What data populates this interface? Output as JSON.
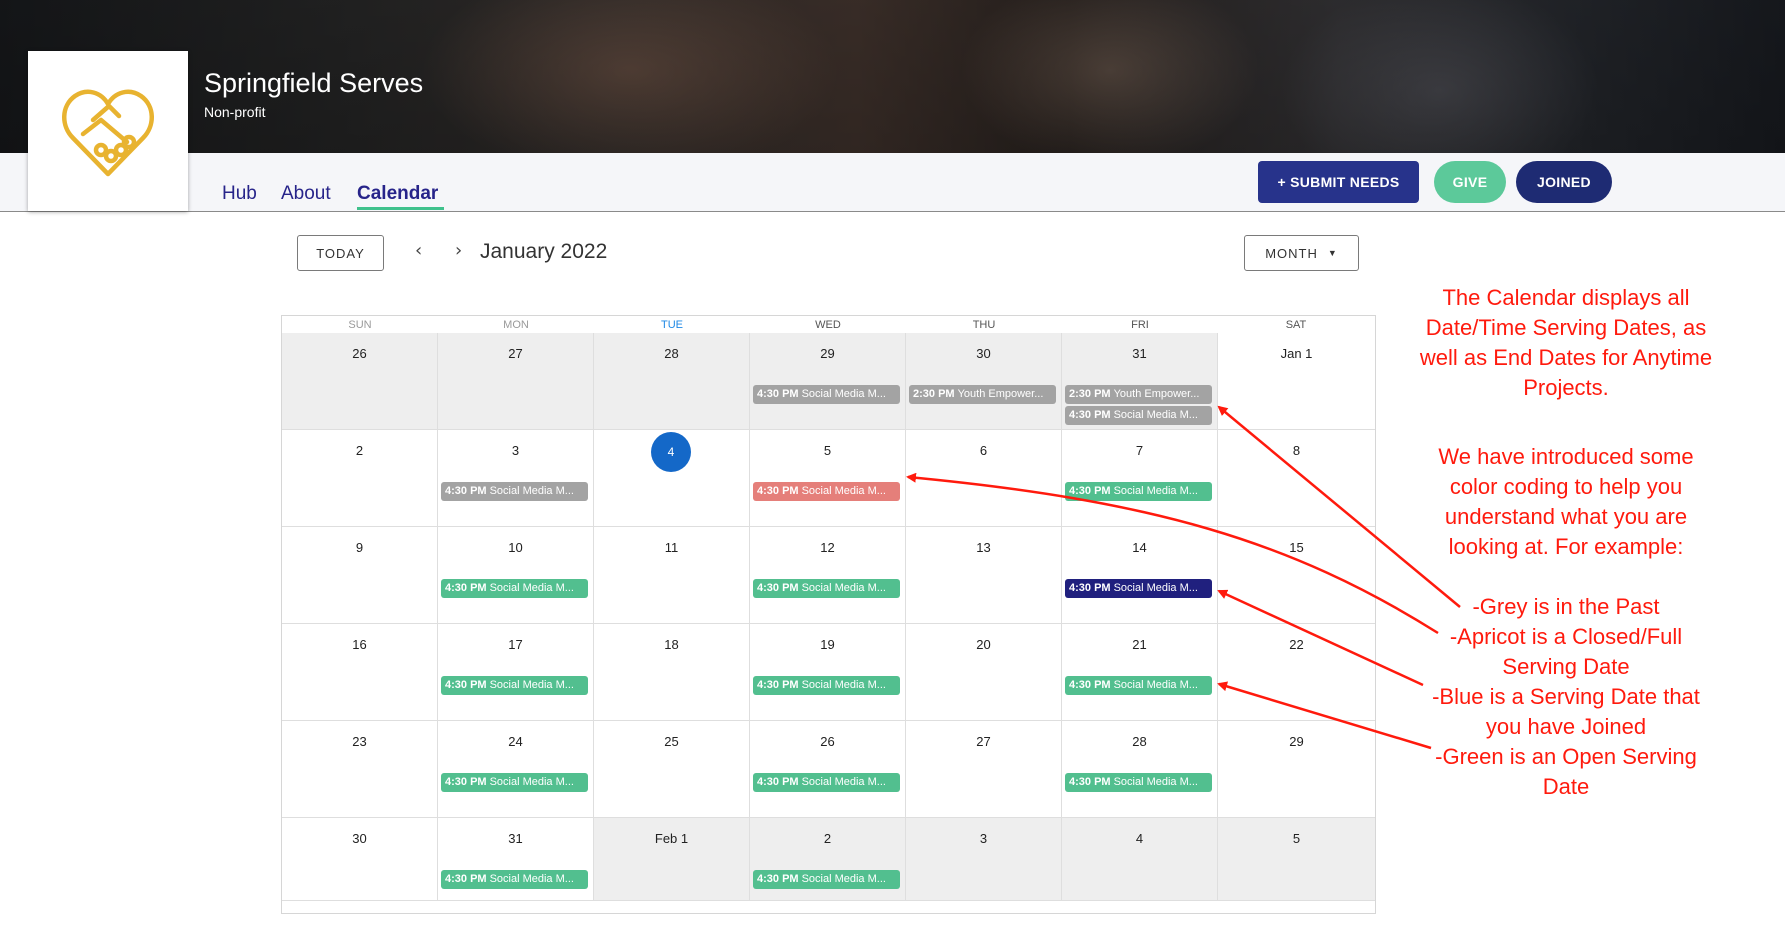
{
  "header": {
    "org_name": "Springfield Serves",
    "org_type": "Non-profit",
    "logo_icon": "handshake-heart-icon"
  },
  "nav": {
    "tabs": [
      {
        "label": "Hub",
        "active": false
      },
      {
        "label": "About",
        "active": false
      },
      {
        "label": "Calendar",
        "active": true
      }
    ],
    "submit_label": "+ SUBMIT NEEDS",
    "give_label": "GIVE",
    "joined_label": "JOINED"
  },
  "toolbar": {
    "today_label": "TODAY",
    "prev_icon": "chevron-left-icon",
    "next_icon": "chevron-right-icon",
    "month_label": "January 2022",
    "view_label": "MONTH"
  },
  "colors": {
    "past": "#a3a3a3",
    "closed": "#e57f7a",
    "open": "#52bf8f",
    "joined": "#20207e",
    "accent": "#1468c8",
    "annotation": "#ff1a0d"
  },
  "calendar": {
    "weekdays": [
      "SUN",
      "MON",
      "TUE",
      "WED",
      "THU",
      "FRI",
      "SAT"
    ],
    "today_day": "4",
    "weeks": [
      [
        {
          "label": "26",
          "grey": true,
          "events": []
        },
        {
          "label": "27",
          "grey": true,
          "events": []
        },
        {
          "label": "28",
          "grey": true,
          "events": []
        },
        {
          "label": "29",
          "grey": true,
          "events": [
            {
              "time": "4:30 PM",
              "title": "Social Media M...",
              "status": "past"
            }
          ]
        },
        {
          "label": "30",
          "grey": true,
          "events": [
            {
              "time": "2:30 PM",
              "title": "Youth Empower...",
              "status": "past"
            }
          ]
        },
        {
          "label": "31",
          "grey": true,
          "events": [
            {
              "time": "2:30 PM",
              "title": "Youth Empower...",
              "status": "past"
            },
            {
              "time": "4:30 PM",
              "title": "Social Media M...",
              "status": "past"
            }
          ]
        },
        {
          "label": "Jan 1",
          "grey": false,
          "events": []
        }
      ],
      [
        {
          "label": "2",
          "grey": false,
          "events": []
        },
        {
          "label": "3",
          "grey": false,
          "events": [
            {
              "time": "4:30 PM",
              "title": "Social Media M...",
              "status": "past"
            }
          ]
        },
        {
          "label": "4",
          "grey": false,
          "today": true,
          "events": []
        },
        {
          "label": "5",
          "grey": false,
          "events": [
            {
              "time": "4:30 PM",
              "title": "Social Media M...",
              "status": "closed"
            }
          ]
        },
        {
          "label": "6",
          "grey": false,
          "events": []
        },
        {
          "label": "7",
          "grey": false,
          "events": [
            {
              "time": "4:30 PM",
              "title": "Social Media M...",
              "status": "open"
            }
          ]
        },
        {
          "label": "8",
          "grey": false,
          "events": []
        }
      ],
      [
        {
          "label": "9",
          "grey": false,
          "events": []
        },
        {
          "label": "10",
          "grey": false,
          "events": [
            {
              "time": "4:30 PM",
              "title": "Social Media M...",
              "status": "open"
            }
          ]
        },
        {
          "label": "11",
          "grey": false,
          "events": []
        },
        {
          "label": "12",
          "grey": false,
          "events": [
            {
              "time": "4:30 PM",
              "title": "Social Media M...",
              "status": "open"
            }
          ]
        },
        {
          "label": "13",
          "grey": false,
          "events": []
        },
        {
          "label": "14",
          "grey": false,
          "events": [
            {
              "time": "4:30 PM",
              "title": "Social Media M...",
              "status": "joined"
            }
          ]
        },
        {
          "label": "15",
          "grey": false,
          "events": []
        }
      ],
      [
        {
          "label": "16",
          "grey": false,
          "events": []
        },
        {
          "label": "17",
          "grey": false,
          "events": [
            {
              "time": "4:30 PM",
              "title": "Social Media M...",
              "status": "open"
            }
          ]
        },
        {
          "label": "18",
          "grey": false,
          "events": []
        },
        {
          "label": "19",
          "grey": false,
          "events": [
            {
              "time": "4:30 PM",
              "title": "Social Media M...",
              "status": "open"
            }
          ]
        },
        {
          "label": "20",
          "grey": false,
          "events": []
        },
        {
          "label": "21",
          "grey": false,
          "events": [
            {
              "time": "4:30 PM",
              "title": "Social Media M...",
              "status": "open"
            }
          ]
        },
        {
          "label": "22",
          "grey": false,
          "events": []
        }
      ],
      [
        {
          "label": "23",
          "grey": false,
          "events": []
        },
        {
          "label": "24",
          "grey": false,
          "events": [
            {
              "time": "4:30 PM",
              "title": "Social Media M...",
              "status": "open"
            }
          ]
        },
        {
          "label": "25",
          "grey": false,
          "events": []
        },
        {
          "label": "26",
          "grey": false,
          "events": [
            {
              "time": "4:30 PM",
              "title": "Social Media M...",
              "status": "open"
            }
          ]
        },
        {
          "label": "27",
          "grey": false,
          "events": []
        },
        {
          "label": "28",
          "grey": false,
          "events": [
            {
              "time": "4:30 PM",
              "title": "Social Media M...",
              "status": "open"
            }
          ]
        },
        {
          "label": "29",
          "grey": false,
          "events": []
        }
      ],
      [
        {
          "label": "30",
          "grey": false,
          "events": []
        },
        {
          "label": "31",
          "grey": false,
          "events": [
            {
              "time": "4:30 PM",
              "title": "Social Media M...",
              "status": "open"
            }
          ]
        },
        {
          "label": "Feb 1",
          "grey": true,
          "events": []
        },
        {
          "label": "2",
          "grey": true,
          "events": [
            {
              "time": "4:30 PM",
              "title": "Social Media M...",
              "status": "open"
            }
          ]
        },
        {
          "label": "3",
          "grey": true,
          "events": []
        },
        {
          "label": "4",
          "grey": true,
          "events": []
        },
        {
          "label": "5",
          "grey": true,
          "events": []
        }
      ]
    ]
  },
  "annotation": {
    "intro_lines": [
      "The Calendar displays all",
      "Date/Time Serving Dates, as",
      "well as End Dates for Anytime",
      "Projects."
    ],
    "coding_lines": [
      "We have introduced some",
      "color coding to help you",
      "understand what you are",
      "looking at. For example:"
    ],
    "legend_lines": [
      "-Grey is in the Past",
      "-Apricot is a Closed/Full",
      "Serving Date",
      "-Blue is a Serving Date that",
      "you have Joined",
      "-Green is an Open Serving",
      "Date"
    ]
  }
}
